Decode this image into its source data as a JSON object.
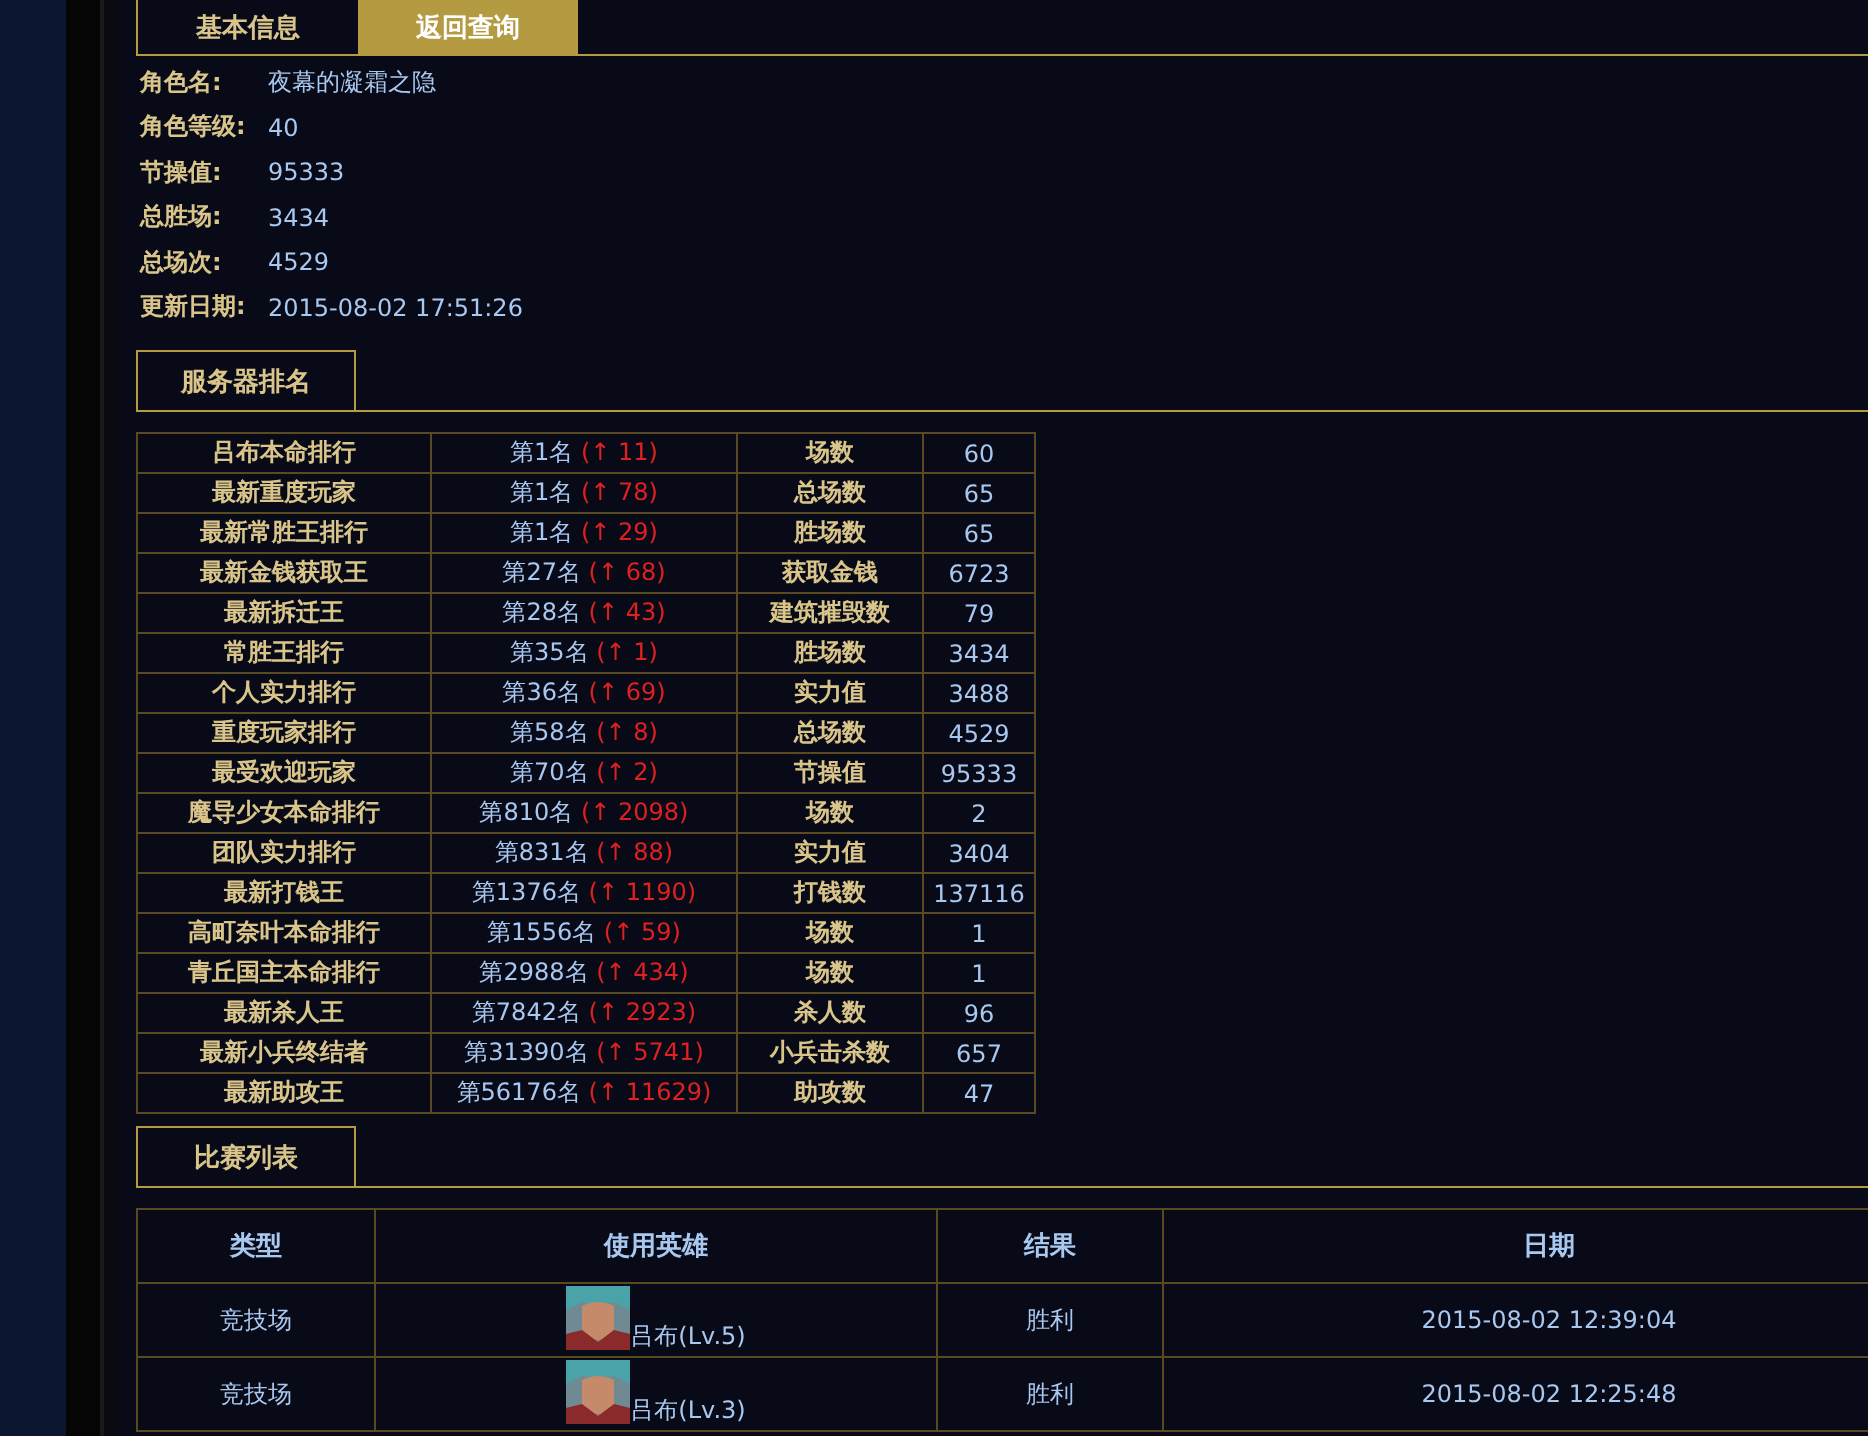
{
  "tabs": [
    {
      "label": "基本信息",
      "selected": false
    },
    {
      "label": "返回查询",
      "selected": true
    }
  ],
  "profile": [
    {
      "label": "角色名:",
      "value": "夜幕的凝霜之隐"
    },
    {
      "label": "角色等级:",
      "value": "40"
    },
    {
      "label": "节操值:",
      "value": "95333"
    },
    {
      "label": "总胜场:",
      "value": "3434"
    },
    {
      "label": "总场次:",
      "value": "4529"
    },
    {
      "label": "更新日期:",
      "value": "2015-08-02 17:51:26"
    }
  ],
  "ranking_section": {
    "title": "服务器排名"
  },
  "rankings": [
    {
      "board": "吕布本命排行",
      "rank": "第1名",
      "change": "(↑ 11)",
      "stat": "场数",
      "value": "60"
    },
    {
      "board": "最新重度玩家",
      "rank": "第1名",
      "change": "(↑ 78)",
      "stat": "总场数",
      "value": "65"
    },
    {
      "board": "最新常胜王排行",
      "rank": "第1名",
      "change": "(↑ 29)",
      "stat": "胜场数",
      "value": "65"
    },
    {
      "board": "最新金钱获取王",
      "rank": "第27名",
      "change": "(↑ 68)",
      "stat": "获取金钱",
      "value": "6723"
    },
    {
      "board": "最新拆迁王",
      "rank": "第28名",
      "change": "(↑ 43)",
      "stat": "建筑摧毁数",
      "value": "79"
    },
    {
      "board": "常胜王排行",
      "rank": "第35名",
      "change": "(↑ 1)",
      "stat": "胜场数",
      "value": "3434"
    },
    {
      "board": "个人实力排行",
      "rank": "第36名",
      "change": "(↑ 69)",
      "stat": "实力值",
      "value": "3488"
    },
    {
      "board": "重度玩家排行",
      "rank": "第58名",
      "change": "(↑ 8)",
      "stat": "总场数",
      "value": "4529"
    },
    {
      "board": "最受欢迎玩家",
      "rank": "第70名",
      "change": "(↑ 2)",
      "stat": "节操值",
      "value": "95333"
    },
    {
      "board": "魔导少女本命排行",
      "rank": "第810名",
      "change": "(↑ 2098)",
      "stat": "场数",
      "value": "2"
    },
    {
      "board": "团队实力排行",
      "rank": "第831名",
      "change": "(↑ 88)",
      "stat": "实力值",
      "value": "3404"
    },
    {
      "board": "最新打钱王",
      "rank": "第1376名",
      "change": "(↑ 1190)",
      "stat": "打钱数",
      "value": "137116"
    },
    {
      "board": "高町奈叶本命排行",
      "rank": "第1556名",
      "change": "(↑ 59)",
      "stat": "场数",
      "value": "1"
    },
    {
      "board": "青丘国主本命排行",
      "rank": "第2988名",
      "change": "(↑ 434)",
      "stat": "场数",
      "value": "1"
    },
    {
      "board": "最新杀人王",
      "rank": "第7842名",
      "change": "(↑ 2923)",
      "stat": "杀人数",
      "value": "96"
    },
    {
      "board": "最新小兵终结者",
      "rank": "第31390名",
      "change": "(↑ 5741)",
      "stat": "小兵击杀数",
      "value": "657"
    },
    {
      "board": "最新助攻王",
      "rank": "第56176名",
      "change": "(↑ 11629)",
      "stat": "助攻数",
      "value": "47"
    }
  ],
  "match_section": {
    "title": "比赛列表"
  },
  "matches": {
    "columns": [
      "类型",
      "使用英雄",
      "结果",
      "日期"
    ],
    "rows": [
      {
        "type": "竞技场",
        "hero": "吕布(Lv.5)",
        "result": "胜利",
        "date": "2015-08-02 12:39:04"
      },
      {
        "type": "竞技场",
        "hero": "吕布(Lv.3)",
        "result": "胜利",
        "date": "2015-08-02 12:25:48"
      }
    ]
  }
}
